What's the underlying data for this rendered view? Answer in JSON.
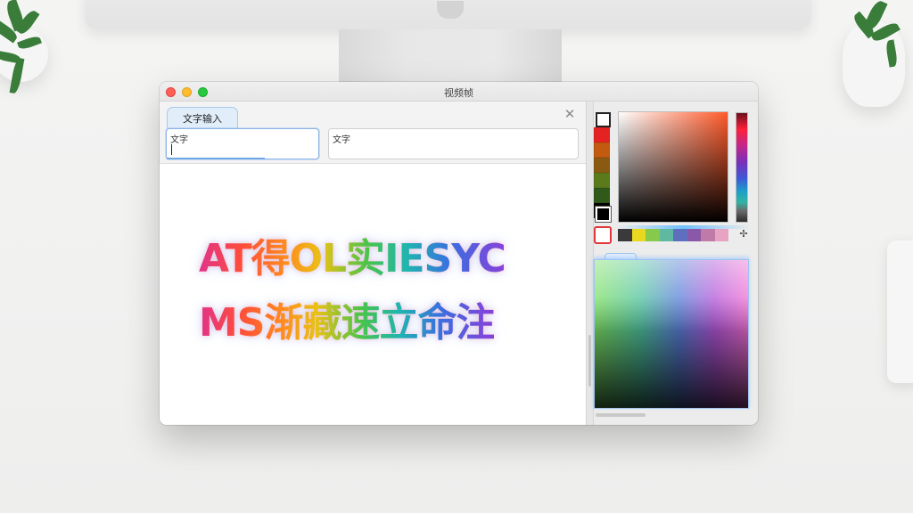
{
  "window": {
    "title": "视频帧"
  },
  "input_panel": {
    "tab_label": "文字输入",
    "close_symbol": "✕",
    "field_1_label": "文字",
    "field_2_label": "文字"
  },
  "canvas": {
    "text_line_1": "AT得OL实IESYC",
    "text_line_2": "MS渐藏速立命注"
  },
  "color_picker": {
    "swatches": [
      "#ffffff",
      "#e52222",
      "#c25a0f",
      "#8a5a12",
      "#5b7a1c",
      "#2f5a1a",
      "#000000"
    ],
    "palette": [
      "#3a3a3a",
      "#e8d820",
      "#86c94b",
      "#5fb8a0",
      "#5e6fc0",
      "#8a58a8",
      "#c07aa8",
      "#e6a3c2"
    ],
    "hue_accent": "#ff5a2a",
    "eyedropper_symbol": "✢"
  }
}
